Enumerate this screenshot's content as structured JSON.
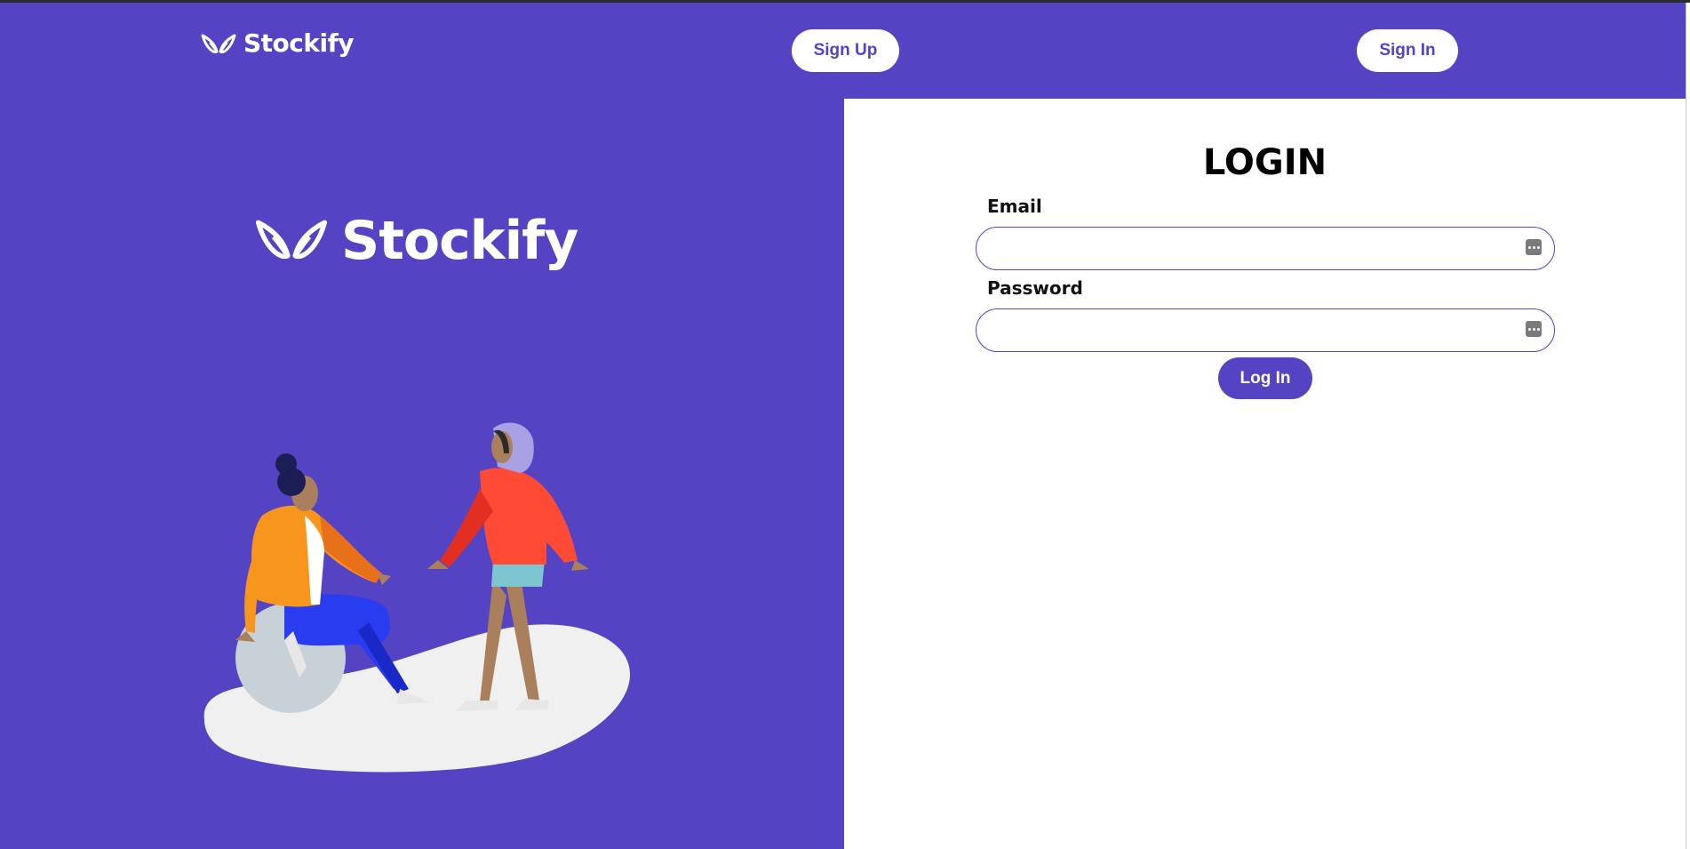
{
  "brand": {
    "name": "Stockify"
  },
  "header": {
    "signup_label": "Sign Up",
    "signin_label": "Sign In"
  },
  "login": {
    "title": "LOGIN",
    "email_label": "Email",
    "email_value": "",
    "password_label": "Password",
    "password_value": "",
    "submit_label": "Log In"
  },
  "icons": {
    "logo": "leaf-wings-logo-icon",
    "password_manager": "password-manager-key-icon"
  },
  "colors": {
    "primary": "#5444c4",
    "background": "#ffffff",
    "hero_text": "#ffffff"
  }
}
